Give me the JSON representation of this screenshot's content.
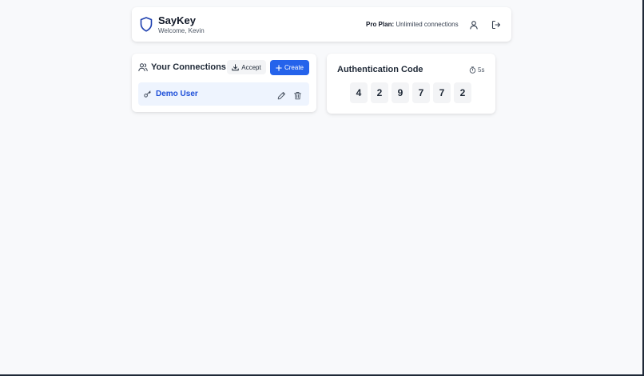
{
  "header": {
    "title": "SayKey",
    "welcome": "Welcome, Kevin",
    "plan_label": "Pro Plan:",
    "plan_value": "Unlimited connections",
    "icons": {
      "logo": "shield-icon",
      "user": "user-icon",
      "logout": "logout-icon"
    }
  },
  "connections": {
    "title": "Your Connections",
    "accept_label": "Accept",
    "create_label": "Create",
    "items": [
      {
        "name": "Demo User",
        "icon": "key-icon"
      }
    ]
  },
  "auth": {
    "title": "Authentication Code",
    "timer": "5s",
    "digits": [
      "4",
      "2",
      "9",
      "7",
      "7",
      "2"
    ]
  },
  "colors": {
    "accent": "#2563eb",
    "shield": "#1e40af",
    "item_bg": "#eef4fe",
    "item_text": "#1d4ed8",
    "page_bg": "#f8f9fb"
  }
}
